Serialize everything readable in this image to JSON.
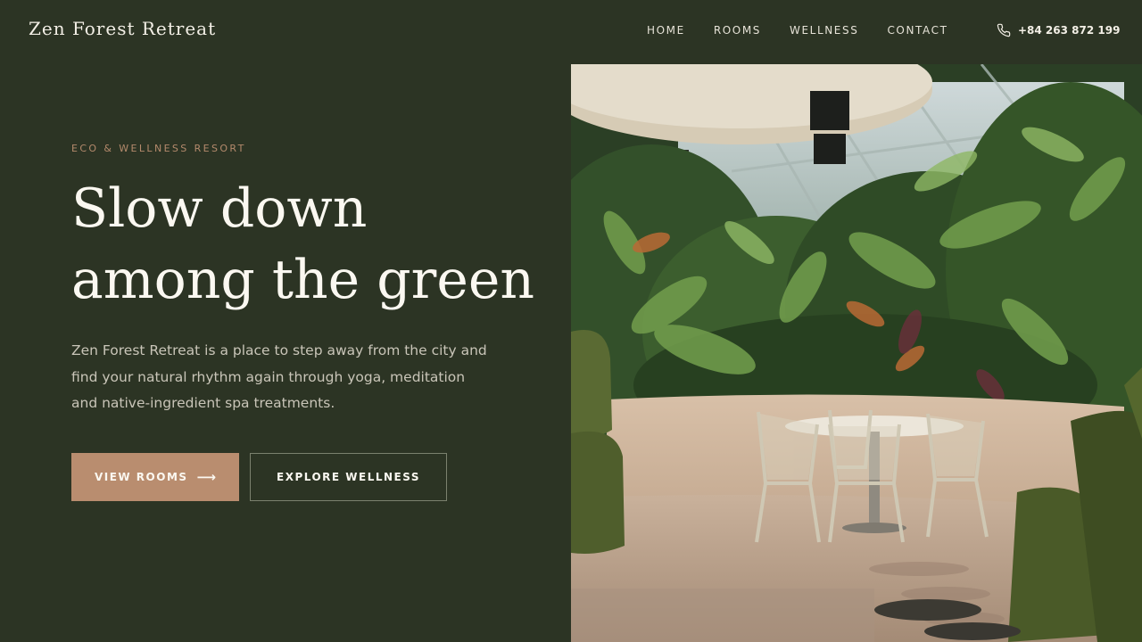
{
  "brand": {
    "name": "Zen Forest Retreat"
  },
  "nav": {
    "items": [
      {
        "label": "HOME"
      },
      {
        "label": "ROOMS"
      },
      {
        "label": "WELLNESS"
      },
      {
        "label": "CONTACT"
      }
    ]
  },
  "phone": {
    "icon": "phone-icon",
    "number": "+84 263 872 199"
  },
  "hero": {
    "eyebrow": "ECO & WELLNESS RESORT",
    "headline_line1": "Slow down",
    "headline_line2": "among the green",
    "description": "Zen Forest Retreat is a place to step away from the city and find your natural rhythm again through yoga, meditation and native-ingredient spa treatments.",
    "primary_button": {
      "label": "VIEW ROOMS",
      "icon": "arrow-right-icon",
      "arrow": "⟶"
    },
    "secondary_button": {
      "label": "EXPLORE WELLNESS"
    },
    "image": {
      "subject": "indoor-garden-with-table-and-chairs"
    }
  },
  "colors": {
    "background": "#2c3424",
    "accent": "#b98d6f",
    "eyebrow": "#b48a6c",
    "heading": "#fbf8f1",
    "body_text": "#c9c5b8",
    "outline_border": "#7b816e"
  }
}
